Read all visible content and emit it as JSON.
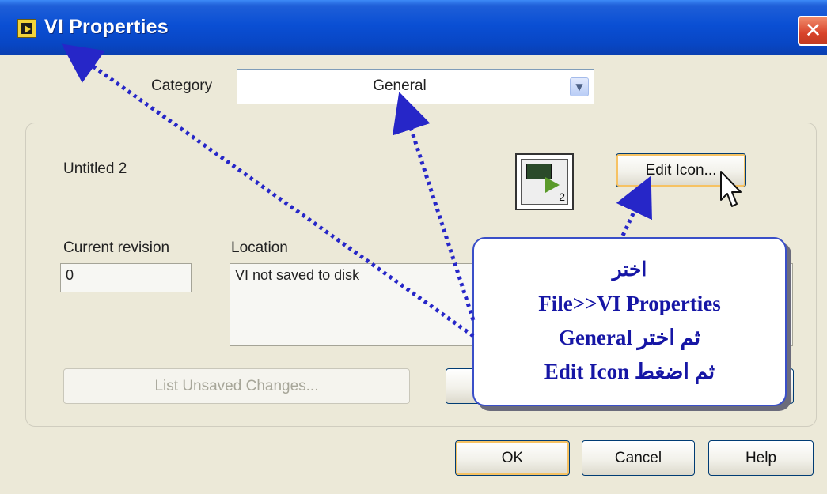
{
  "window": {
    "title": "VI Properties",
    "close_symbol": "✕"
  },
  "category": {
    "label": "Category",
    "value": "General"
  },
  "general": {
    "vi_name": "Untitled 2",
    "edit_icon_label": "Edit Icon...",
    "current_revision_label": "Current revision",
    "current_revision_value": "0",
    "location_label": "Location",
    "location_value": "VI not saved to disk",
    "list_unsaved_label": "List Unsaved Changes...",
    "icon_digit": "2"
  },
  "footer": {
    "ok_label": "OK",
    "cancel_label": "Cancel",
    "help_label": "Help"
  },
  "callout": {
    "line1": "اختر",
    "line2": "File>>VI Properties",
    "line3": "ثم اختر General",
    "line4": "ثم اضغط Edit Icon"
  },
  "colors": {
    "titlebar": "#0a4fd4",
    "callout_text": "#1616a5",
    "arrow": "#2626c8"
  },
  "icons": [
    "app-icon",
    "close-icon",
    "chevron-down-icon",
    "vi-icon",
    "pointer-cursor-icon"
  ]
}
